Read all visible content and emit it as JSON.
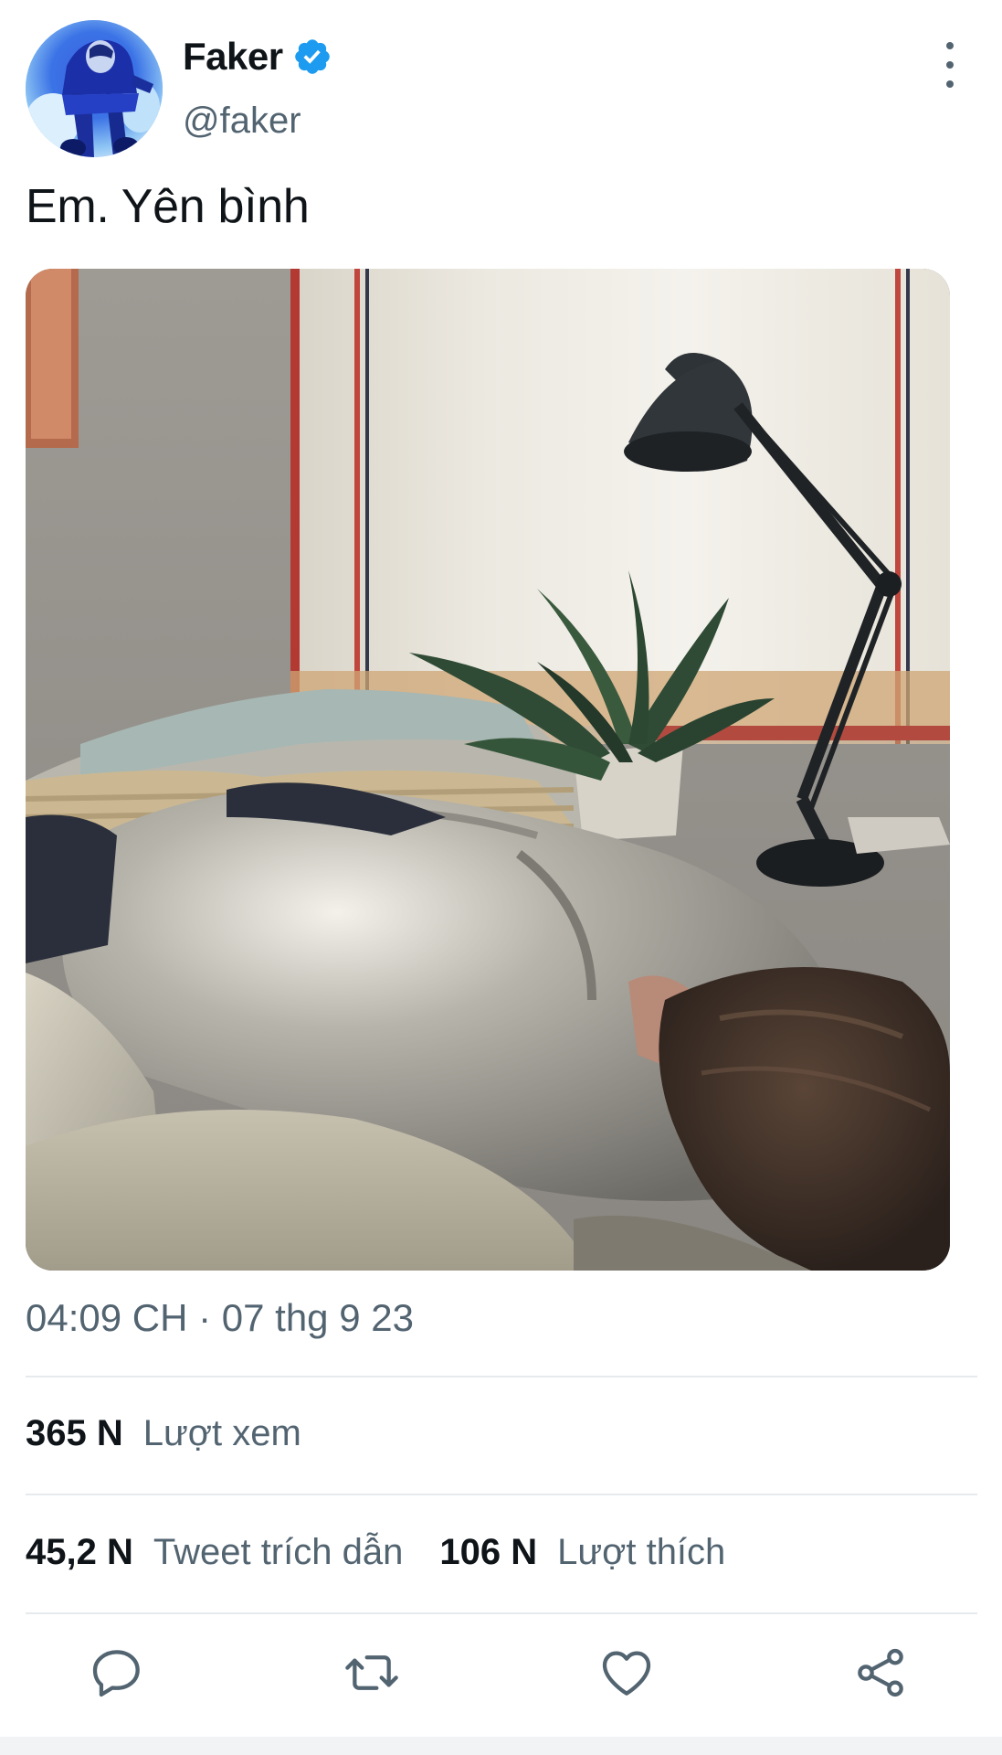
{
  "author": {
    "display_name": "Faker",
    "handle": "@faker",
    "verified": true,
    "avatar_icon": "profile-photo"
  },
  "tweet": {
    "text": "Em. Yên bình",
    "timestamp": "04:09 CH · 07 thg 9 23",
    "media_icon": "photo-person-sleeping-on-bed"
  },
  "stats": {
    "views_value": "365 N",
    "views_label": "Lượt xem",
    "quotes_value": "45,2 N",
    "quotes_label": "Tweet trích dẫn",
    "likes_value": "106 N",
    "likes_label": "Lượt thích"
  },
  "actions": {
    "reply_icon": "reply-icon",
    "retweet_icon": "retweet-icon",
    "like_icon": "heart-icon",
    "share_icon": "share-icon"
  },
  "colors": {
    "primary_text": "#0f1419",
    "secondary_text": "#536471",
    "verified_blue": "#1d9bf0",
    "divider": "#e6eaed"
  }
}
